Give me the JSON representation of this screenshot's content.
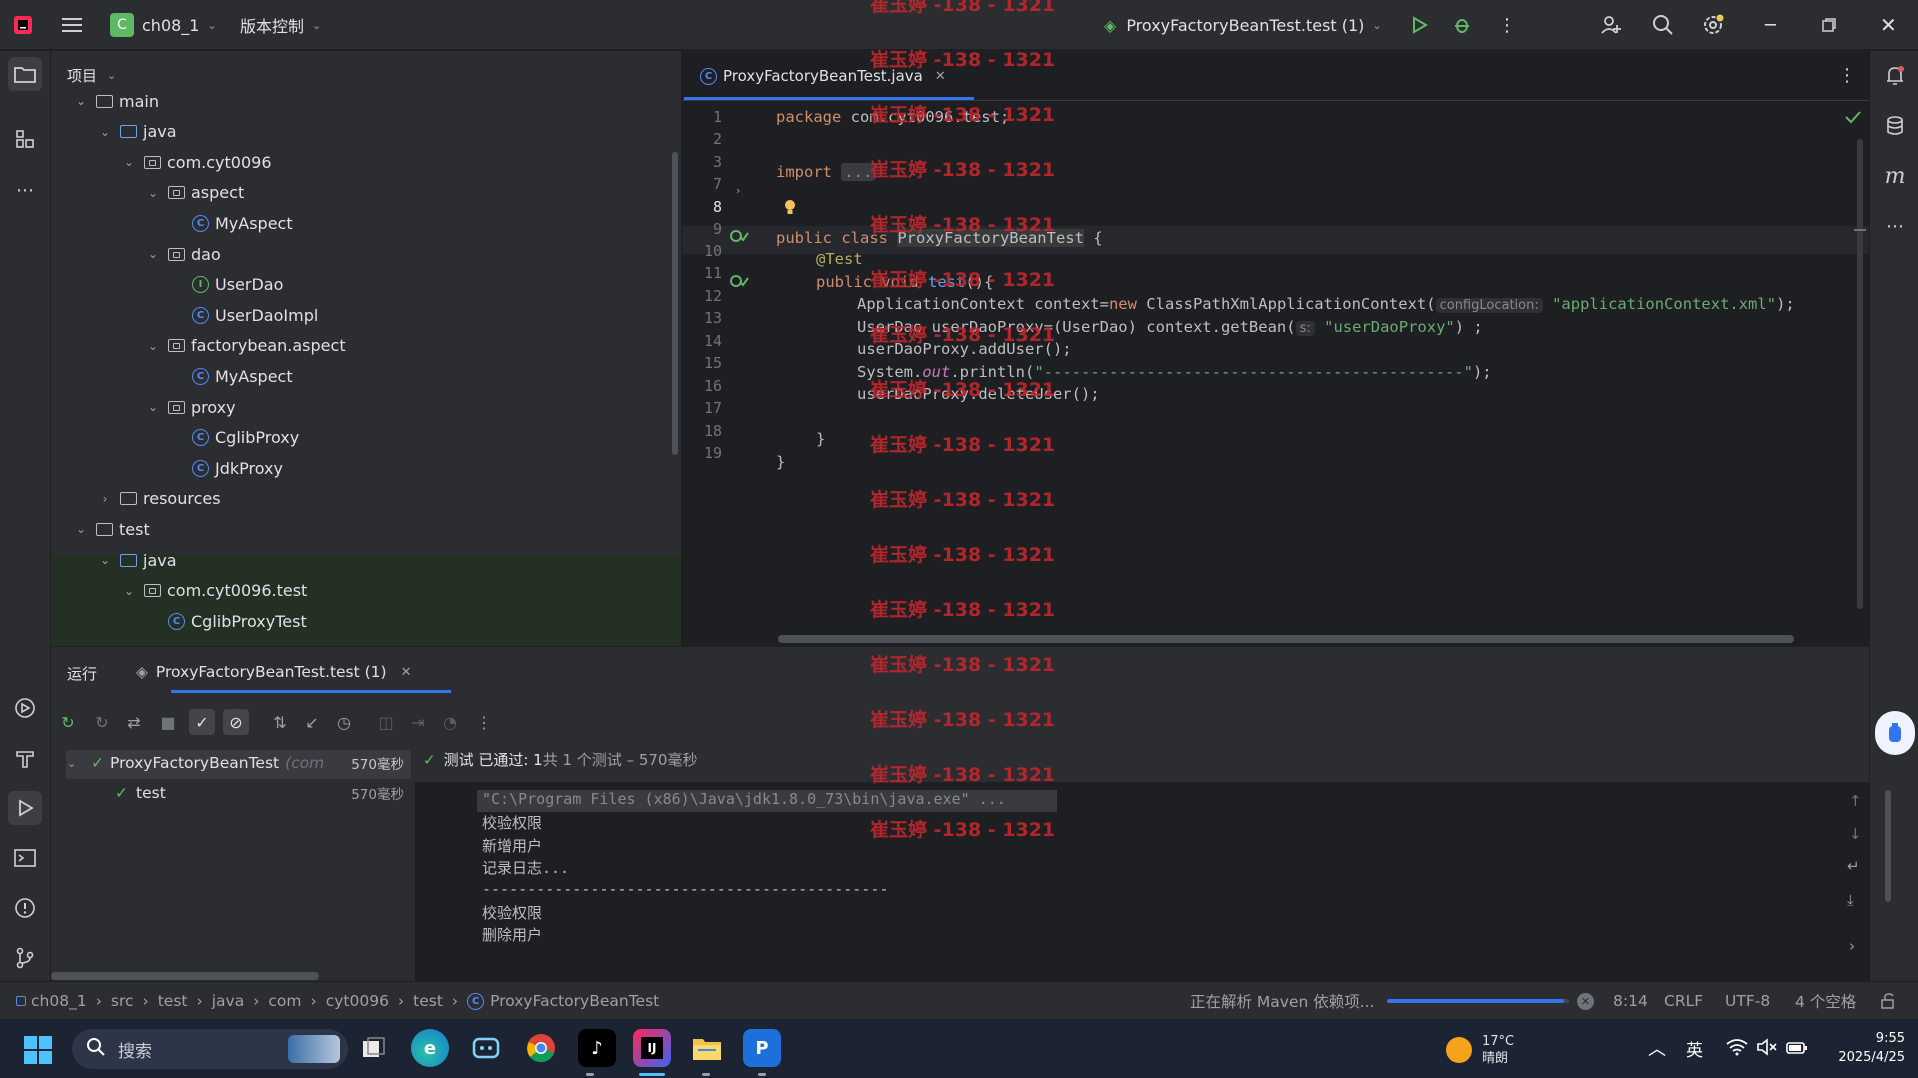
{
  "titlebar": {
    "project_badge": "C",
    "project_name": "ch08_1",
    "vcs_label": "版本控制",
    "run_config": "ProxyFactoryBeanTest.test (1)"
  },
  "project_panel": {
    "title": "项目",
    "tree": [
      {
        "label": "main",
        "kind": "folder"
      },
      {
        "label": "java",
        "kind": "src"
      },
      {
        "label": "com.cyt0096",
        "kind": "pkg"
      },
      {
        "label": "aspect",
        "kind": "pkg"
      },
      {
        "label": "MyAspect",
        "kind": "class"
      },
      {
        "label": "dao",
        "kind": "pkg"
      },
      {
        "label": "UserDao",
        "kind": "interface"
      },
      {
        "label": "UserDaoImpl",
        "kind": "class"
      },
      {
        "label": "factorybean.aspect",
        "kind": "pkg"
      },
      {
        "label": "MyAspect",
        "kind": "class"
      },
      {
        "label": "proxy",
        "kind": "pkg"
      },
      {
        "label": "CglibProxy",
        "kind": "class"
      },
      {
        "label": "JdkProxy",
        "kind": "class"
      },
      {
        "label": "resources",
        "kind": "folder"
      },
      {
        "label": "test",
        "kind": "folder"
      },
      {
        "label": "java",
        "kind": "src"
      },
      {
        "label": "com.cyt0096.test",
        "kind": "pkg"
      },
      {
        "label": "CglibProxyTest",
        "kind": "class"
      }
    ]
  },
  "editor": {
    "tab_label": "ProxyFactoryBeanTest.java",
    "line_numbers": [
      "1",
      "2",
      "3",
      "7",
      "8",
      "9",
      "10",
      "11",
      "12",
      "13",
      "14",
      "15",
      "16",
      "17",
      "18",
      "19"
    ],
    "code": {
      "l1_kw": "package",
      "l1_rest": " com.cyt0096.test;",
      "l3_kw": "import",
      "l3_fold": "...",
      "l8_kw": "public class",
      "l8_name": "ProxyFactoryBeanTest",
      "l8_rest": " {",
      "l9": "@Test",
      "l10_kw": "public void",
      "l10_fn": "test",
      "l10_rest": "(){",
      "l11_a": "ApplicationContext context=",
      "l11_new": "new",
      "l11_b": " ClassPathXmlApplicationContext(",
      "l11_hint": "configLocation:",
      "l11_str": "\"applicationContext.xml\"",
      "l11_end": ");",
      "l12_a": "UserDao userDaoProxy=(UserDao) context.getBean(",
      "l12_hint": "s:",
      "l12_str": "\"userDaoProxy\"",
      "l12_end": ") ;",
      "l13": "userDaoProxy.addUser();",
      "l14_a": "System.",
      "l14_out": "out",
      "l14_b": ".println(",
      "l14_str": "\"---------------------------------------------\"",
      "l14_end": ");",
      "l15": "userDaoProxy.deleteUser();",
      "l17": "}",
      "l18": "}"
    }
  },
  "run_panel": {
    "tab_run": "运行",
    "tab_config": "ProxyFactoryBeanTest.test (1)",
    "tests": [
      {
        "name": "ProxyFactoryBeanTest",
        "suffix": "(com",
        "time": "570毫秒"
      },
      {
        "name": "test",
        "suffix": "",
        "time": "570毫秒"
      }
    ],
    "summary_prefix": "测试 已通过: 1",
    "summary_rest": "共 1 个测试 – 570毫秒",
    "console": [
      "\"C:\\Program Files (x86)\\Java\\jdk1.8.0_73\\bin\\java.exe\" ...",
      "校验权限",
      "新增用户",
      "记录日志...",
      "---------------------------------------------",
      "校验权限",
      "删除用户"
    ]
  },
  "statusbar": {
    "breadcrumb": [
      "ch08_1",
      "src",
      "test",
      "java",
      "com",
      "cyt0096",
      "test",
      "ProxyFactoryBeanTest"
    ],
    "task": "正在解析 Maven 依赖项...",
    "task_progress": 0.97,
    "position": "8:14",
    "line_sep": "CRLF",
    "encoding": "UTF-8",
    "indent": "4 个空格"
  },
  "taskbar": {
    "search_placeholder": "搜索",
    "weather_temp": "17°C",
    "weather_desc": "晴朗",
    "ime": "英",
    "time": "9:55",
    "date": "2025/4/25"
  },
  "watermark": "崔玉婷 -138 - 1321",
  "colors": {
    "accent": "#3574f0",
    "pass": "#5fb865",
    "watermark": "#c0272d"
  }
}
